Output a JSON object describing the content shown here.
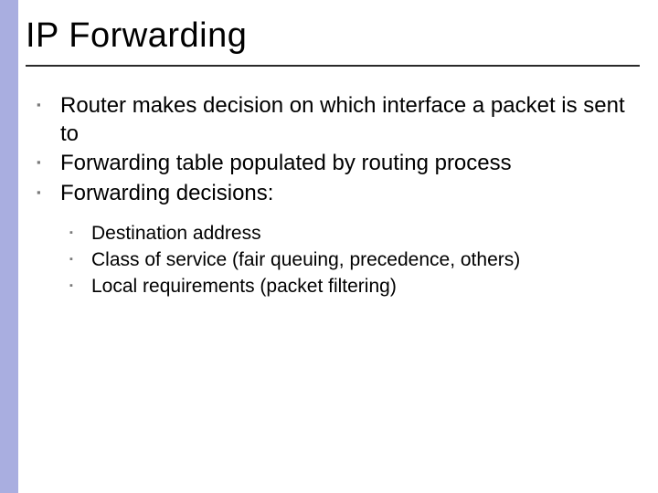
{
  "slide": {
    "title": "IP Forwarding",
    "bullets": [
      {
        "text": "Router makes decision on which interface a packet is sent to"
      },
      {
        "text": "Forwarding table populated by routing process"
      },
      {
        "text": "Forwarding decisions:"
      }
    ],
    "sub_bullets": [
      {
        "text": "Destination address"
      },
      {
        "text": "Class of service (fair queuing, precedence, others)"
      },
      {
        "text": "Local requirements (packet filtering)"
      }
    ]
  },
  "colors": {
    "sidebar": "#a9aee0",
    "bullet": "#7a7a7a"
  }
}
